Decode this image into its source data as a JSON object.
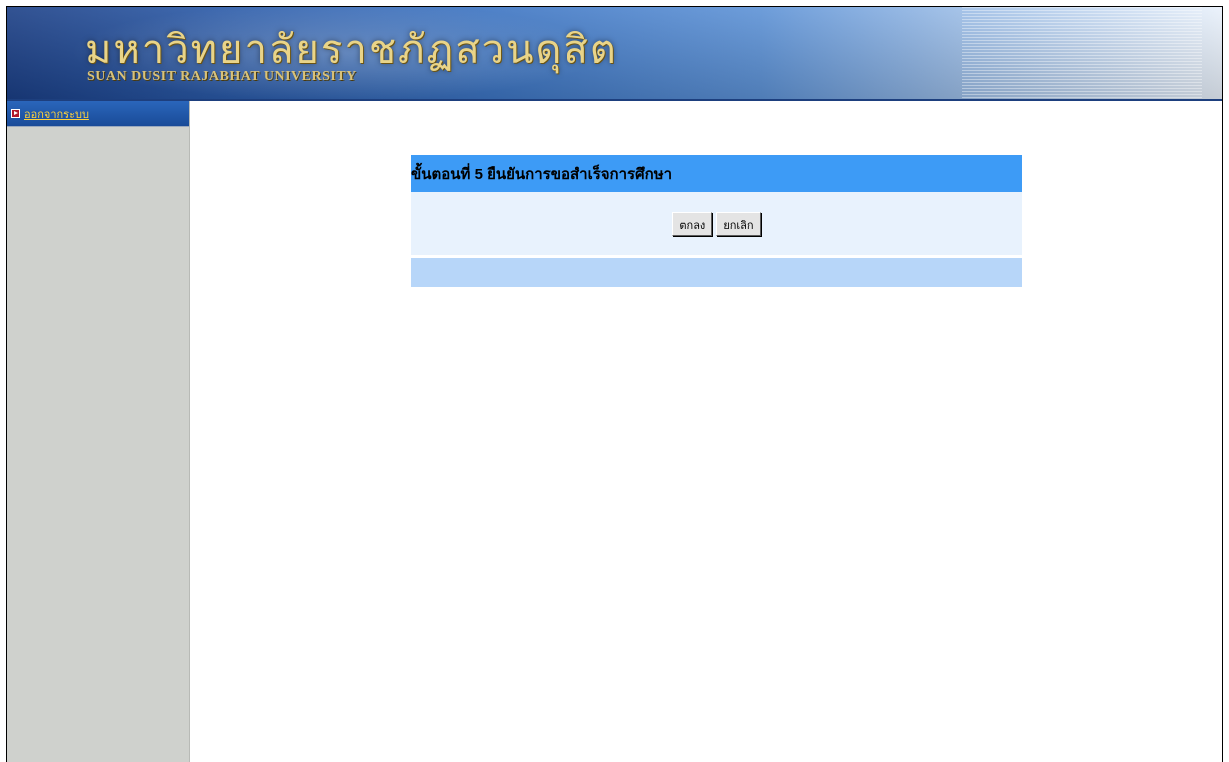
{
  "banner": {
    "title_thai": "มหาวิทยาลัยราชภัฏสวนดุสิต",
    "title_english": "SUAN DUSIT RAJABHAT UNIVERSITY"
  },
  "sidebar": {
    "items": [
      {
        "label": "ออกจากระบบ",
        "icon": "exit-arrow-icon"
      }
    ]
  },
  "dialog": {
    "title": "ขั้นตอนที่ 5 ยืนยันการขอสำเร็จการศึกษา",
    "ok_label": "ตกลง",
    "cancel_label": "ยกเลิก"
  },
  "colors": {
    "header_blue": "#3d9bf6",
    "body_light_blue": "#e8f2fd",
    "footer_blue": "#b7d6f9",
    "sidebar_gray": "#cfd1cd",
    "sidebar_item_blue": "#1d55a8",
    "sidebar_label_yellow": "#ffd23a"
  }
}
